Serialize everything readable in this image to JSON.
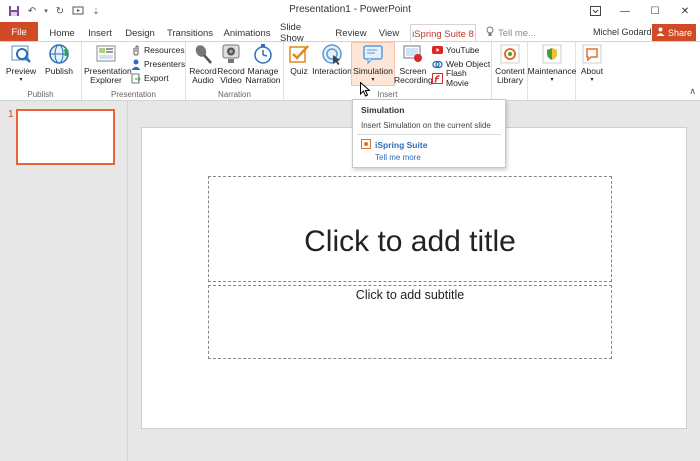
{
  "window": {
    "title": "Presentation1 - PowerPoint",
    "minimize": "—",
    "maximize": "☐",
    "close": "✕"
  },
  "tabs": {
    "file": "File",
    "items": [
      "Home",
      "Insert",
      "Design",
      "Transitions",
      "Animations",
      "Slide Show",
      "Review",
      "View"
    ],
    "active": "iSpring Suite 8"
  },
  "tellme": {
    "placeholder": "Tell me..."
  },
  "user": {
    "name": "Michel Godard",
    "share": "Share"
  },
  "ribbon": {
    "publish": {
      "label": "Publish",
      "preview": "Preview",
      "publish_btn": "Publish"
    },
    "presentation": {
      "label": "Presentation",
      "explorer": "Presentation Explorer",
      "resources": "Resources",
      "presenters": "Presenters",
      "export": "Export"
    },
    "narration": {
      "label": "Narration",
      "record_audio": "Record Audio",
      "record_video": "Record Video",
      "manage_narration": "Manage Narration"
    },
    "insert": {
      "label": "Insert",
      "quiz": "Quiz",
      "interaction": "Interaction",
      "simulation": "Simulation",
      "screen_recording": "Screen Recording",
      "youtube": "YouTube",
      "web_object": "Web Object",
      "flash_movie": "Flash Movie"
    },
    "other": {
      "content_library": "Content Library",
      "maintenance": "Maintenance",
      "about": "About"
    }
  },
  "tooltip": {
    "title": "Simulation",
    "description": "Insert Simulation on the current slide",
    "brand": "iSpring Suite",
    "tell_more": "Tell me more"
  },
  "slides": {
    "number": "1",
    "title_placeholder": "Click to add title",
    "subtitle_placeholder": "Click to add subtitle"
  },
  "colors": {
    "accent": "#d04a25",
    "link": "#2c6fb8"
  }
}
